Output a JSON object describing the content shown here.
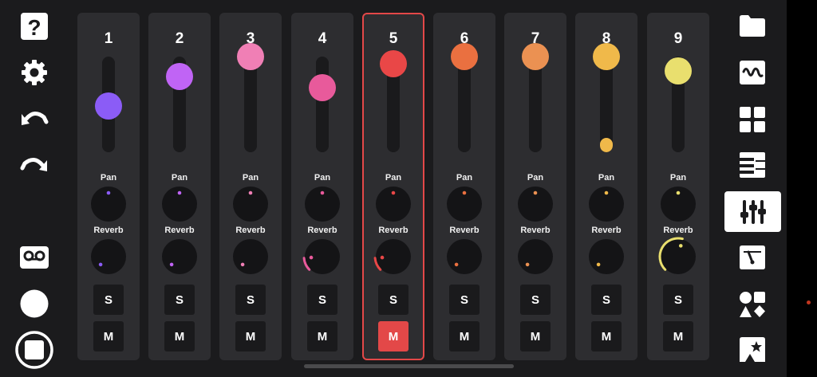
{
  "left_toolbar": {
    "help_icon": "question-mark-icon",
    "settings_icon": "gear-icon",
    "undo_icon": "undo-icon",
    "redo_icon": "redo-icon",
    "recordings_icon": "tape-icon",
    "record_icon": "record-circle-icon",
    "stop_icon": "stop-icon"
  },
  "right_toolbar": {
    "items": [
      {
        "name": "folder-icon",
        "selected": false
      },
      {
        "name": "waveform-icon",
        "selected": false
      },
      {
        "name": "grid-pads-icon",
        "selected": false
      },
      {
        "name": "keyboard-icon",
        "selected": false
      },
      {
        "name": "mixer-sliders-icon",
        "selected": true
      },
      {
        "name": "tuner-meter-icon",
        "selected": false
      },
      {
        "name": "shapes-icon",
        "selected": false
      },
      {
        "name": "star-tag-icon",
        "selected": false
      }
    ]
  },
  "mixer": {
    "pan_label": "Pan",
    "reverb_label": "Reverb",
    "solo_label": "S",
    "mute_label": "M",
    "selected_channel": "5",
    "channels": [
      {
        "number": "1",
        "color": "#8b5cf6",
        "volume": 0.38,
        "pan": 0.5,
        "reverb": 0.0,
        "solo": false,
        "mute": false
      },
      {
        "number": "2",
        "color": "#c064f5",
        "volume": 0.75,
        "pan": 0.5,
        "reverb": 0.0,
        "solo": false,
        "mute": false
      },
      {
        "number": "3",
        "color": "#f07fb5",
        "volume": 1.0,
        "pan": 0.5,
        "reverb": 0.0,
        "solo": false,
        "mute": false
      },
      {
        "number": "4",
        "color": "#e85a9b",
        "volume": 0.61,
        "pan": 0.5,
        "reverb": 0.15,
        "solo": false,
        "mute": false
      },
      {
        "number": "5",
        "color": "#e94747",
        "volume": 0.91,
        "pan": 0.5,
        "reverb": 0.15,
        "solo": false,
        "mute": true
      },
      {
        "number": "6",
        "color": "#ea7040",
        "volume": 1.0,
        "pan": 0.5,
        "reverb": 0.0,
        "solo": false,
        "mute": false
      },
      {
        "number": "7",
        "color": "#eb9152",
        "volume": 1.0,
        "pan": 0.5,
        "reverb": 0.0,
        "solo": false,
        "mute": false
      },
      {
        "number": "8",
        "color": "#f0b94a",
        "volume": 1.0,
        "meter": 0.15,
        "pan": 0.5,
        "reverb": 0.0,
        "solo": false,
        "mute": false
      },
      {
        "number": "9",
        "color": "#e9df6e",
        "volume": 0.82,
        "pan": 0.5,
        "reverb": 0.55,
        "solo": false,
        "mute": false
      }
    ]
  }
}
